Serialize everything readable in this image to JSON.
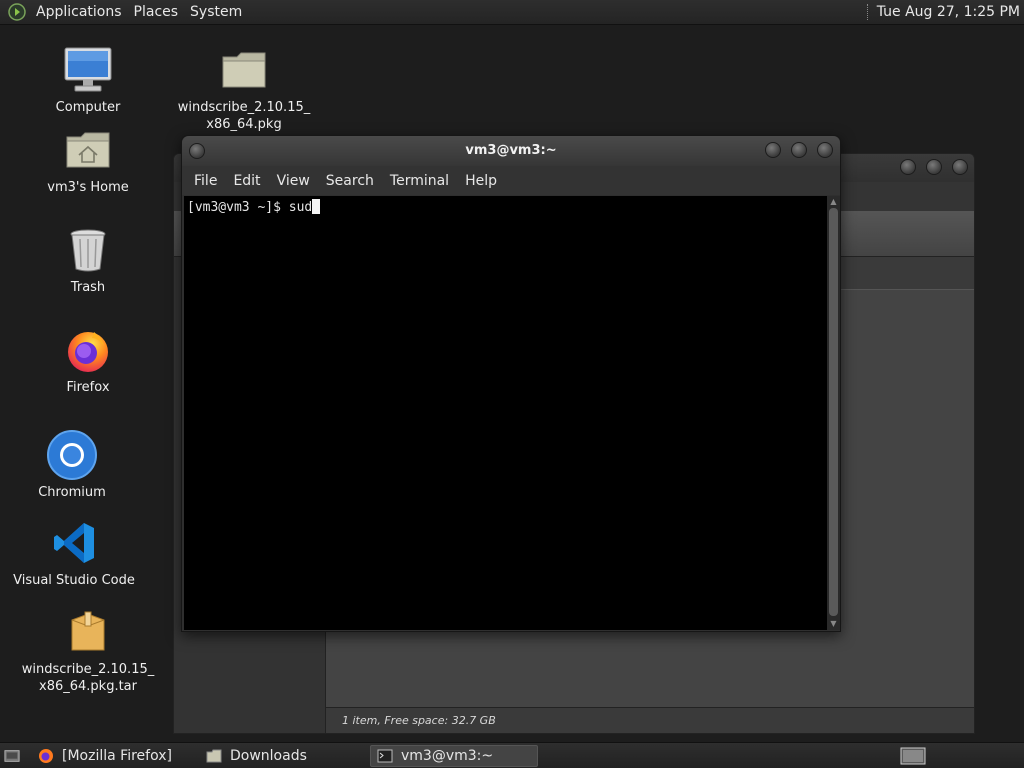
{
  "top_panel": {
    "menus": [
      "Applications",
      "Places",
      "System"
    ],
    "clock": "Tue Aug 27,  1:25 PM"
  },
  "desktop_icons": [
    {
      "label_line1": "Computer",
      "label_line2": "",
      "icon": "computer-icon"
    },
    {
      "label_line1": "windscribe_2.10.15_",
      "label_line2": "x86_64.pkg",
      "icon": "folder-icon"
    },
    {
      "label_line1": "vm3's Home",
      "label_line2": "",
      "icon": "home-folder-icon"
    },
    {
      "label_line1": "Trash",
      "label_line2": "",
      "icon": "trash-icon"
    },
    {
      "label_line1": "Firefox",
      "label_line2": "",
      "icon": "firefox-icon"
    },
    {
      "label_line1": "Chromium",
      "label_line2": "",
      "icon": "chromium-icon"
    },
    {
      "label_line1": "Visual Studio Code",
      "label_line2": "",
      "icon": "vscode-icon"
    },
    {
      "label_line1": "windscribe_2.10.15_",
      "label_line2": "x86_64.pkg.tar",
      "icon": "archive-icon"
    }
  ],
  "file_manager": {
    "status": "1 item, Free space: 32.7 GB"
  },
  "terminal": {
    "title": "vm3@vm3:~",
    "menu": [
      "File",
      "Edit",
      "View",
      "Search",
      "Terminal",
      "Help"
    ],
    "prompt": "[vm3@vm3 ~]$ sud"
  },
  "taskbar": {
    "tasks": [
      "[Mozilla Firefox]",
      "Downloads",
      "vm3@vm3:~"
    ]
  },
  "colors": {
    "desktop_bg": "#1d1d1d",
    "panel_bg": "#2a2a2a",
    "terminal_bg": "#000000"
  }
}
